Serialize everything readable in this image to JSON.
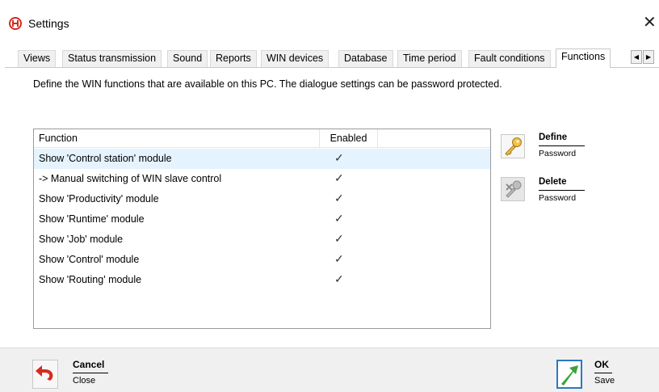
{
  "window": {
    "title": "Settings",
    "close_glyph": "✕"
  },
  "tabs": [
    {
      "label": "Views"
    },
    {
      "label": "Status transmission"
    },
    {
      "label": "Sound"
    },
    {
      "label": "Reports"
    },
    {
      "label": "WIN devices"
    },
    {
      "label": "Database"
    },
    {
      "label": "Time period"
    },
    {
      "label": "Fault conditions"
    },
    {
      "label": "Functions",
      "active": true
    }
  ],
  "tab_scroll": {
    "left": "◀",
    "right": "▶"
  },
  "description": "Define the WIN functions that are available on this PC. The dialogue settings can be password protected.",
  "table": {
    "columns": [
      "Function",
      "Enabled"
    ],
    "rows": [
      {
        "function": "Show 'Control station' module",
        "enabled": "✓",
        "selected": true
      },
      {
        "function": "-> Manual switching of WIN slave control",
        "enabled": "✓"
      },
      {
        "function": "Show 'Productivity' module",
        "enabled": "✓"
      },
      {
        "function": "Show 'Runtime' module",
        "enabled": "✓"
      },
      {
        "function": "Show 'Job' module",
        "enabled": "✓"
      },
      {
        "function": "Show 'Control' module",
        "enabled": "✓"
      },
      {
        "function": "Show 'Routing' module",
        "enabled": "✓"
      }
    ]
  },
  "password_actions": {
    "define": {
      "label": "Define",
      "sub": "Password",
      "icon": "key-icon"
    },
    "delete": {
      "label": "Delete",
      "sub": "Password",
      "icon": "key-delete-icon",
      "disabled": true
    }
  },
  "footer": {
    "cancel": {
      "label": "Cancel",
      "sub": "Close",
      "icon": "undo-arrow-icon"
    },
    "ok": {
      "label": "OK",
      "sub": "Save",
      "icon": "green-arrow-icon"
    }
  },
  "colors": {
    "selected_row": "#e5f3ff",
    "footer_bg": "#f0f0f0",
    "logo_red": "#d62a1e",
    "ok_green": "#3aa33a",
    "ok_border": "#2b78c2"
  }
}
